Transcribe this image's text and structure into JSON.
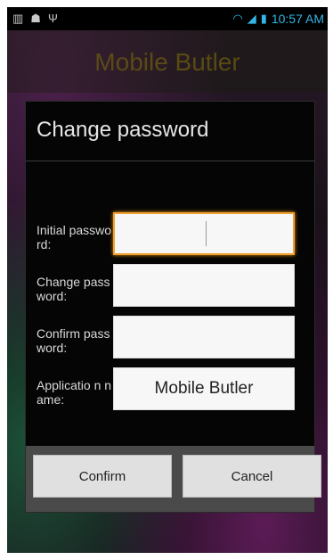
{
  "status_bar": {
    "time": "10:57 AM",
    "icons": [
      "keyboard-icon",
      "android-icon",
      "usb-icon",
      "wifi-icon",
      "signal-icon",
      "battery-icon"
    ]
  },
  "app": {
    "title": "Mobile Butler"
  },
  "dialog": {
    "title": "Change password",
    "fields": {
      "initial_password_label": "Initial password:",
      "change_password_label": "Change password:",
      "confirm_password_label": "Confirm password:",
      "application_name_label": "Applicatio n name:",
      "application_name_value": "Mobile Butler"
    },
    "buttons": {
      "confirm": "Confirm",
      "cancel": "Cancel"
    }
  }
}
